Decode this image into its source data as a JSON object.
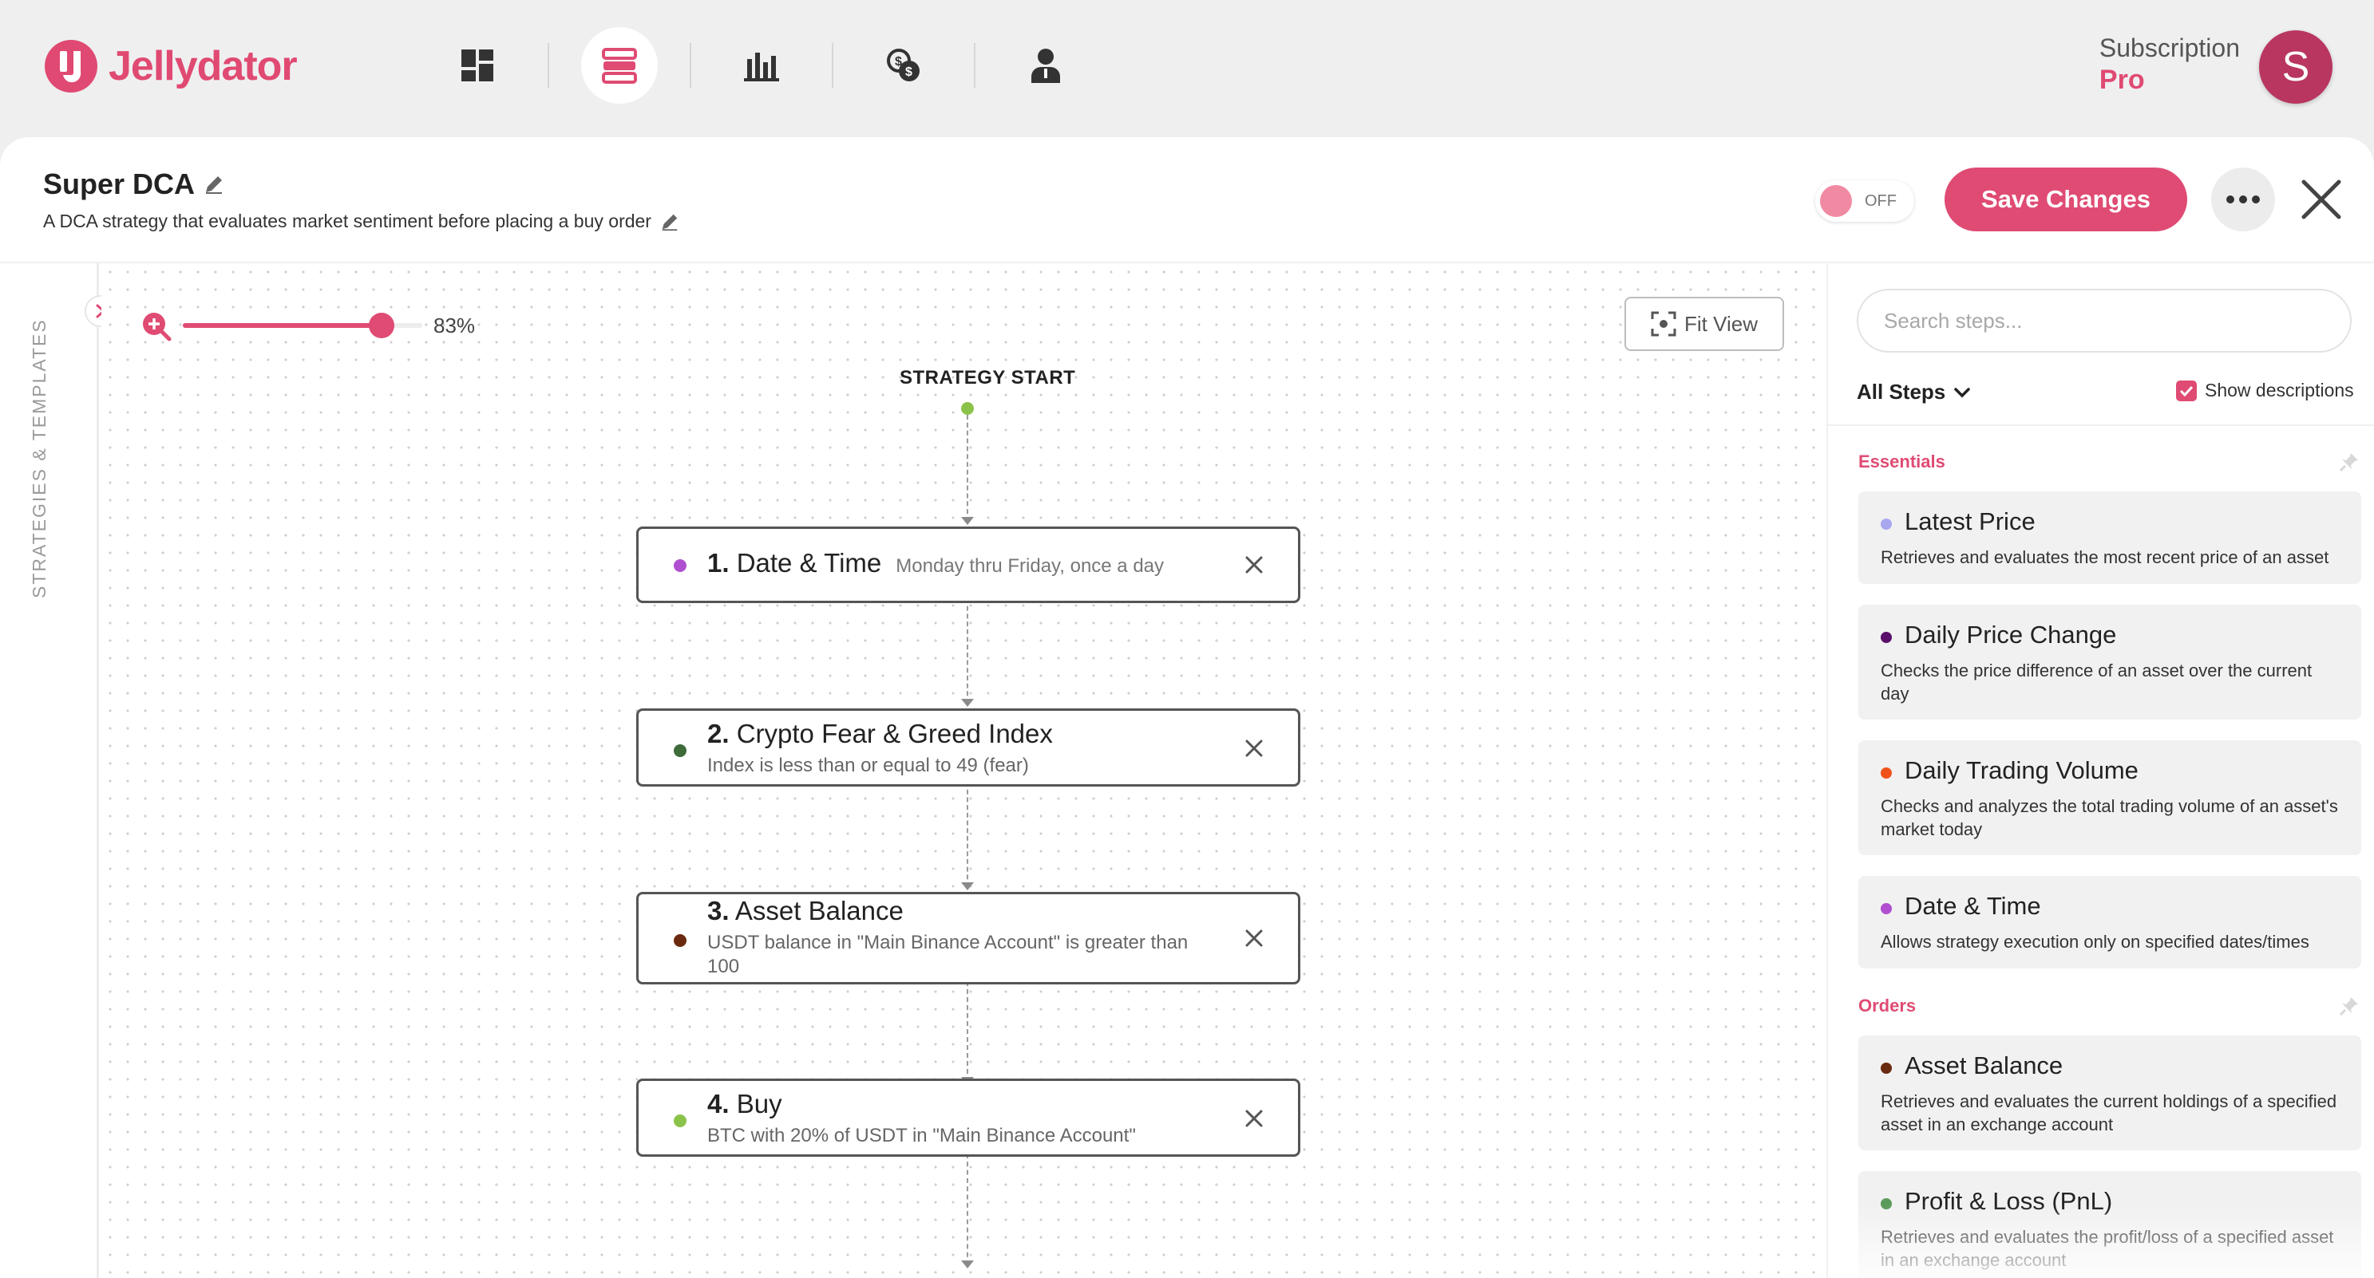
{
  "app": {
    "name": "Jellydator",
    "brand_color": "#df4b73",
    "nav": [
      {
        "name": "dashboard-icon",
        "active": false
      },
      {
        "name": "strategy-builder-icon",
        "active": true
      },
      {
        "name": "chart-icon",
        "active": false
      },
      {
        "name": "exchange-icon",
        "active": false
      },
      {
        "name": "account-icon",
        "active": false
      }
    ],
    "subscription_label": "Subscription",
    "subscription_plan": "Pro",
    "avatar_initial": "S"
  },
  "strategy": {
    "title": "Super DCA",
    "description": "A DCA strategy that evaluates market sentiment before placing a buy order",
    "toggle_label": "OFF",
    "save_label": "Save Changes"
  },
  "rail": {
    "label": "STRATEGIES & TEMPLATES"
  },
  "canvas": {
    "zoom_value": "83%",
    "zoom_fraction": 0.83,
    "fit_label": "Fit View",
    "start_label": "STRATEGY START",
    "steps": [
      {
        "number": "1.",
        "title": "Date & Time",
        "inline": "Monday thru Friday, once a day",
        "desc": "",
        "color": "#b04fd0"
      },
      {
        "number": "2.",
        "title": "Crypto Fear & Greed Index",
        "inline": "",
        "desc": "Index is less than or equal to 49 (fear)",
        "color": "#3d6b3a"
      },
      {
        "number": "3.",
        "title": "Asset Balance",
        "inline": "",
        "desc": "USDT balance in \"Main Binance Account\" is greater than 100",
        "color": "#6b2a10"
      },
      {
        "number": "4.",
        "title": "Buy",
        "inline": "",
        "desc": "BTC with 20% of USDT in \"Main Binance Account\"",
        "color": "#8bc34a"
      }
    ]
  },
  "panel": {
    "search_placeholder": "Search steps...",
    "filter_label": "All Steps",
    "show_desc_label": "Show descriptions",
    "sections": [
      {
        "label": "Essentials"
      },
      {
        "label": "Orders"
      }
    ],
    "items": [
      {
        "title": "Latest Price",
        "desc": "Retrieves and evaluates the most recent price of an asset",
        "color": "#a9a6f0"
      },
      {
        "title": "Daily Price Change",
        "desc": "Checks the price difference of an asset over the current day",
        "color": "#5a0f6a"
      },
      {
        "title": "Daily Trading Volume",
        "desc": "Checks and analyzes the total trading volume of an asset's market today",
        "color": "#f0521c"
      },
      {
        "title": "Date & Time",
        "desc": "Allows strategy execution only on specified dates/times",
        "color": "#b04fd0"
      },
      {
        "title": "Asset Balance",
        "desc": "Retrieves and evaluates the current holdings of a specified asset in an exchange account",
        "color": "#6b2a10"
      },
      {
        "title": "Profit & Loss (PnL)",
        "desc": "Retrieves and evaluates the profit/loss of a specified asset in an exchange account",
        "color": "#5a9a5a"
      }
    ]
  }
}
